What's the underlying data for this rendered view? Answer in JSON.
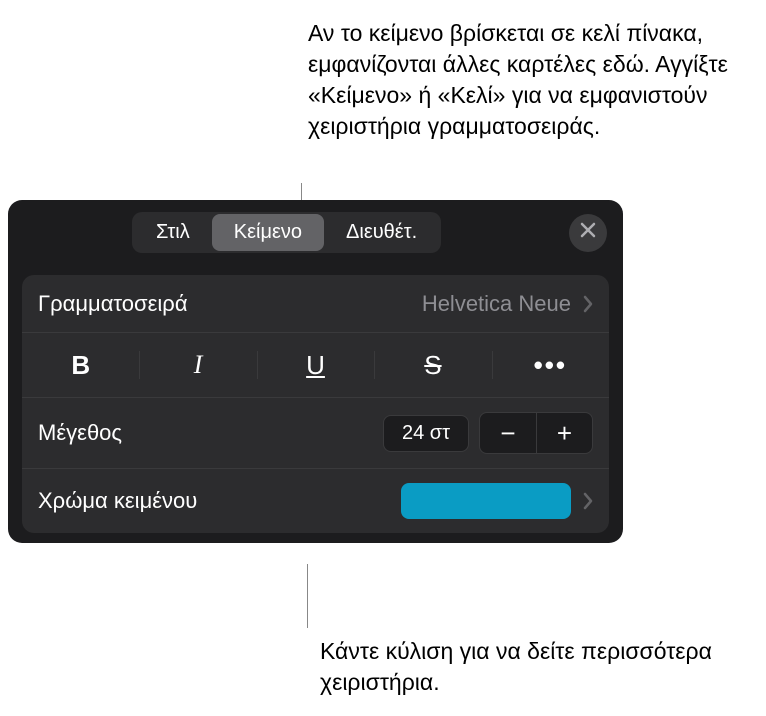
{
  "callouts": {
    "top": "Αν το κείμενο βρίσκεται σε κελί πίνακα, εμφανίζονται άλλες καρτέλες εδώ. Αγγίξτε «Κείμενο» ή «Κελί» για να εμφανιστούν χειριστήρια γραμματοσειράς.",
    "bottom": "Κάντε κύλιση για να δείτε περισσότερα χειριστήρια."
  },
  "tabs": {
    "style": "Στιλ",
    "text": "Κείμενο",
    "arrange": "Διευθέτ."
  },
  "font": {
    "label": "Γραμματοσειρά",
    "value": "Helvetica Neue"
  },
  "style_buttons": {
    "bold": "B",
    "italic": "I",
    "underline": "U",
    "strike": "S",
    "more": "•••"
  },
  "size": {
    "label": "Μέγεθος",
    "value": "24 στ",
    "minus": "−",
    "plus": "+"
  },
  "text_color": {
    "label": "Χρώμα κειμένου",
    "hex": "#0a9cc4"
  }
}
